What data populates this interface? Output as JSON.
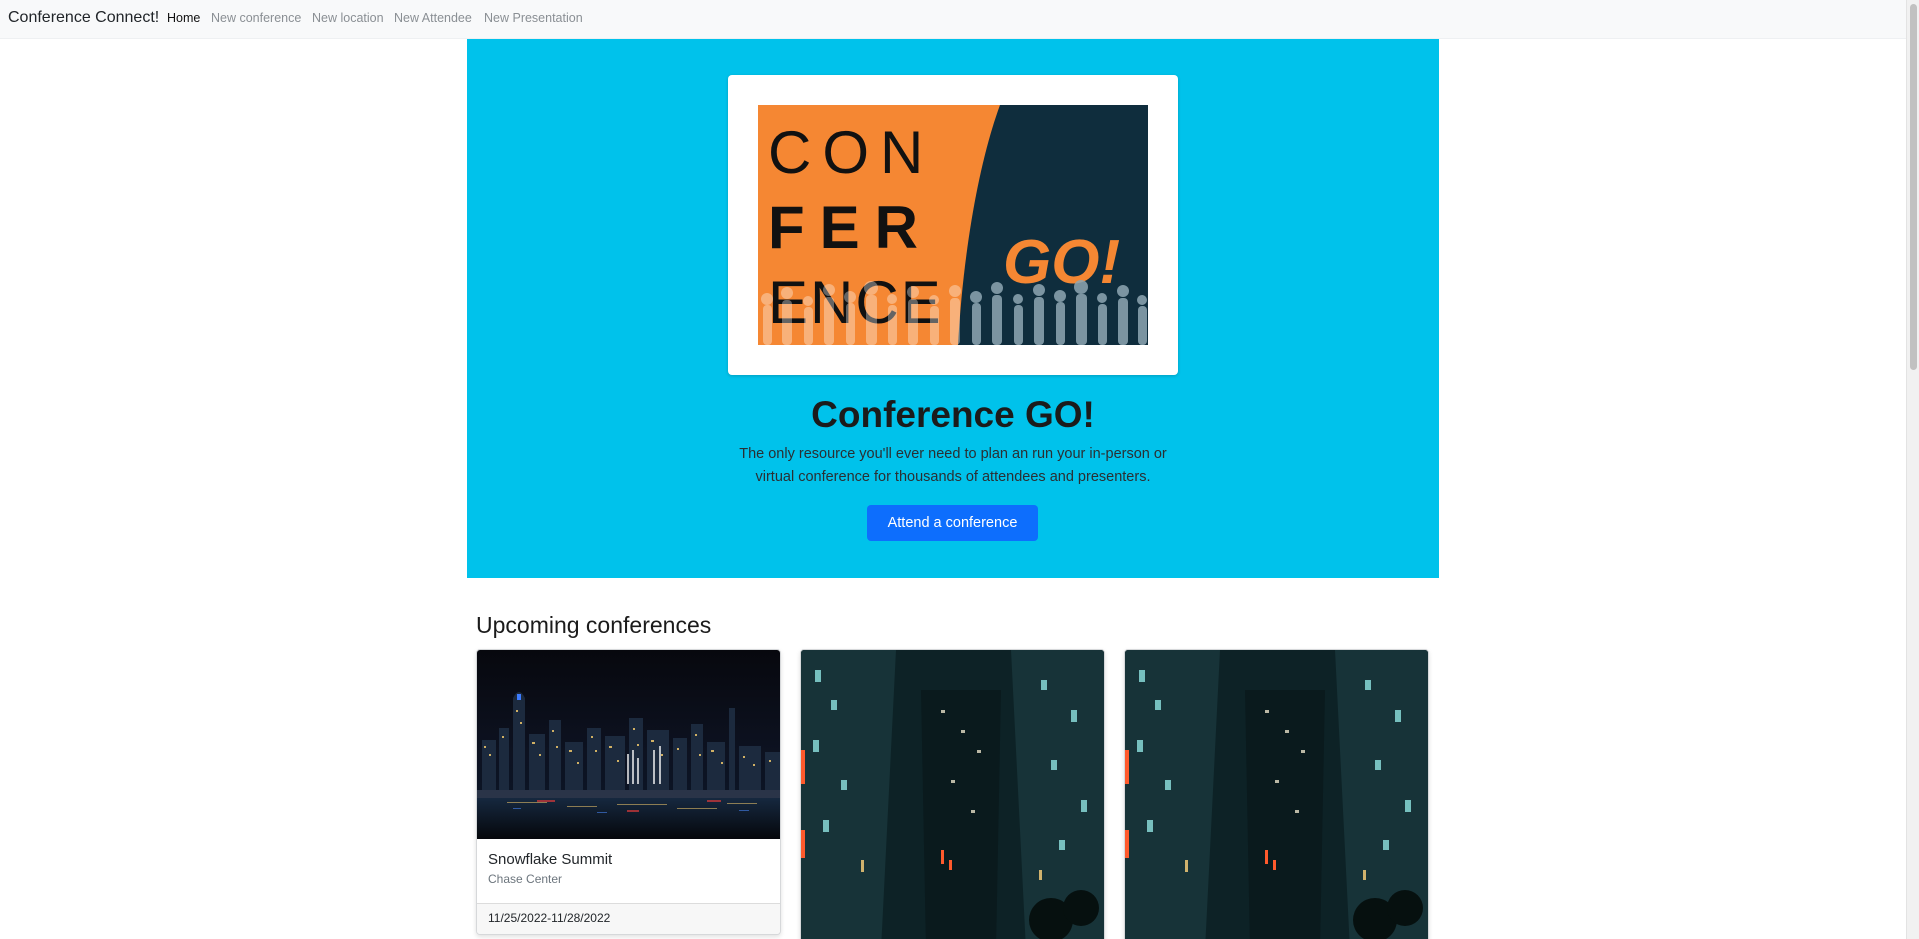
{
  "nav": {
    "brand": "Conference Connect!",
    "links": [
      {
        "label": "Home",
        "active": true
      },
      {
        "label": "New conference",
        "active": false
      },
      {
        "label": "New location",
        "active": false
      },
      {
        "label": "New Attendee",
        "active": false
      },
      {
        "label": "New Presentation",
        "active": false
      }
    ]
  },
  "hero": {
    "logo_text": {
      "line1": "CON",
      "line2": "FER",
      "line3": "ENCE",
      "go": "GO!"
    },
    "title": "Conference GO!",
    "lead_line1": "The only resource you'll ever need to plan an run your in-person or",
    "lead_line2": "virtual conference for thousands of attendees and presenters.",
    "button": "Attend a conference",
    "bg_color": "#00c2eb"
  },
  "upcoming": {
    "heading": "Upcoming conferences",
    "cards": [
      {
        "name": "Snowflake Summit",
        "location": "Chase Center",
        "dates": "11/25/2022-11/28/2022",
        "image": "city-skyline-night"
      },
      {
        "image": "city-street-night"
      },
      {
        "image": "city-street-night"
      }
    ]
  },
  "colors": {
    "primary": "#0d6efd",
    "logo_orange": "#f58733",
    "logo_navy": "#0f2d3d"
  }
}
